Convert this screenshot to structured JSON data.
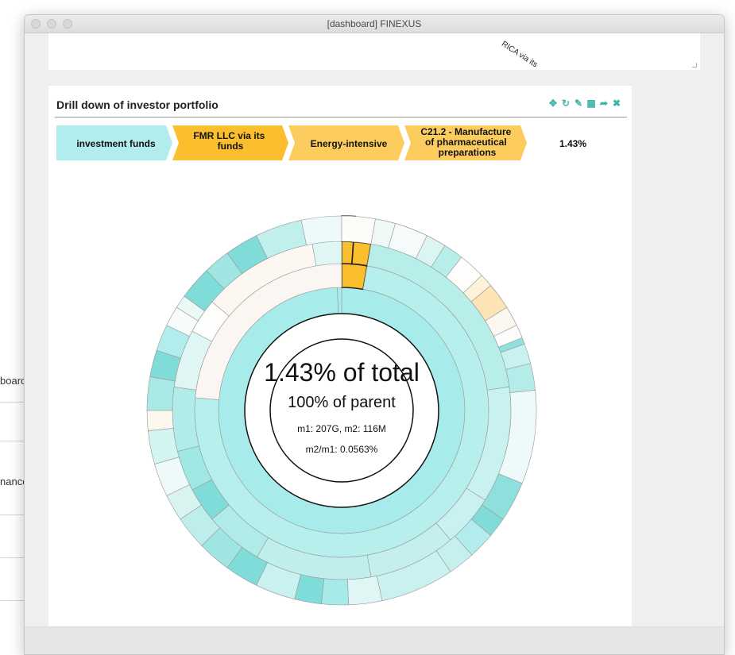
{
  "window": {
    "title": "[dashboard] FINEXUS"
  },
  "background_window": {
    "snippets": [
      "boarc",
      "nance"
    ]
  },
  "top_panel": {
    "rotated_label": "RICA via its"
  },
  "panel": {
    "title": "Drill down of investor portfolio",
    "toolbar": [
      {
        "name": "move-icon",
        "glyph": "✥"
      },
      {
        "name": "refresh-icon",
        "glyph": "↻"
      },
      {
        "name": "edit-icon",
        "glyph": "✎"
      },
      {
        "name": "table-icon",
        "glyph": "▦"
      },
      {
        "name": "share-icon",
        "glyph": "➦"
      },
      {
        "name": "close-icon",
        "glyph": "✖"
      }
    ]
  },
  "breadcrumb": {
    "items": [
      {
        "label": "investment funds",
        "color": "#b3ecec"
      },
      {
        "label": "FMR LLC via its funds",
        "color": "#fbbf2d"
      },
      {
        "label": "Energy-intensive",
        "color": "#fccc5e"
      },
      {
        "label": "C21.2 - Manufacture of pharmaceutical preparations",
        "color": "#fccc5e"
      }
    ],
    "value": "1.43%"
  },
  "center": {
    "pct_total": "1.43% of total",
    "pct_parent": "100% of parent",
    "metrics": "m1: 207G, m2: 116M",
    "ratio": "m2/m1: 0.0563%"
  },
  "colors": {
    "teal": "#7fdcd8",
    "teal_light": "#b3ecec",
    "gold": "#fbbf2d",
    "cream": "#fbf4e6"
  }
}
